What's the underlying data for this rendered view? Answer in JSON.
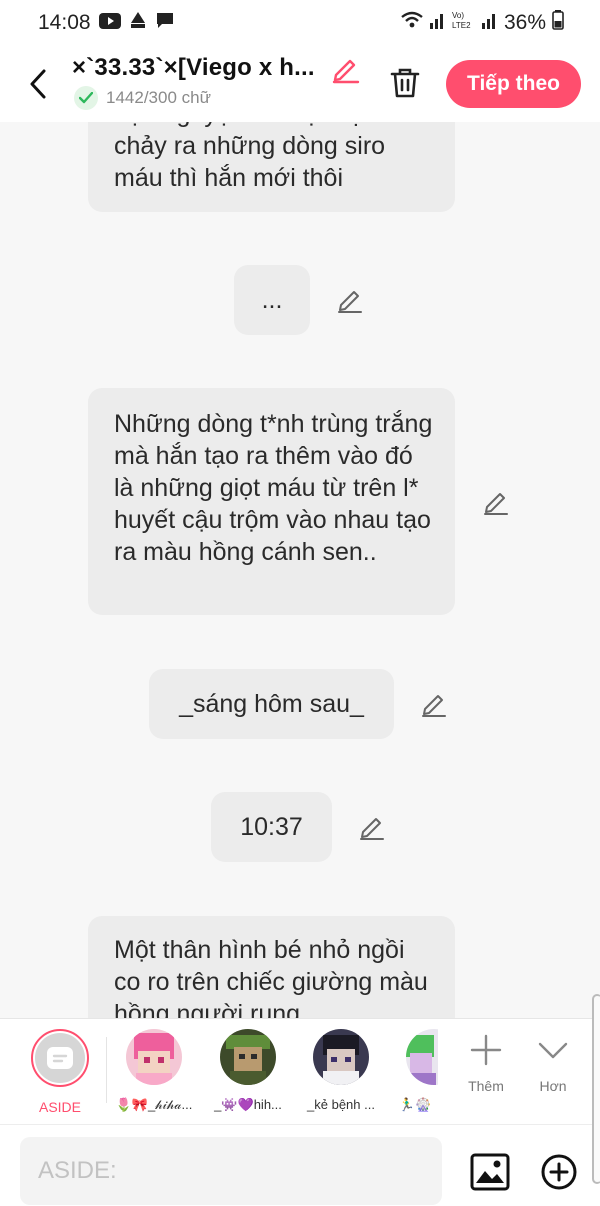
{
  "status_bar": {
    "time": "14:08",
    "carrier_label": "Vo) LTE2",
    "battery": "36%"
  },
  "header": {
    "title": "×`33.33`×[Viego x h...",
    "word_count": "1442/300 chữ",
    "next_label": "Tiếp theo"
  },
  "messages": [
    {
      "text": "hậu nguyệt của cậu bị rách chảy ra những dòng siro máu thì hắn mới thôi"
    },
    {
      "text": "..."
    },
    {
      "text": "Những dòng t*nh trùng trắng mà hắn tạo ra thêm vào đó là những giọt máu từ trên l* huyết cậu trộm vào nhau tạo ra màu hồng cánh sen.."
    },
    {
      "text": "_sáng hôm sau_"
    },
    {
      "text": "10:37"
    },
    {
      "text": "Một thân hình bé nhỏ ngồi co ro trên chiếc giường màu hồng người rung"
    }
  ],
  "characters": {
    "aside_label": "ASIDE",
    "list": [
      {
        "name": "🌷🎀_𝒽𝒾𝒽𝒶..."
      },
      {
        "name": "_👾💜hih..."
      },
      {
        "name": "_kẻ bệnh ..."
      },
      {
        "name": "🏃‍♂️🎡"
      }
    ],
    "add_label": "Thêm",
    "more_label": "Hơn"
  },
  "input": {
    "placeholder": "ASIDE:"
  },
  "colors": {
    "accent": "#ff4e6e",
    "bubble": "#ececec",
    "background": "#f7f7f7",
    "check": "#2eb85c"
  }
}
